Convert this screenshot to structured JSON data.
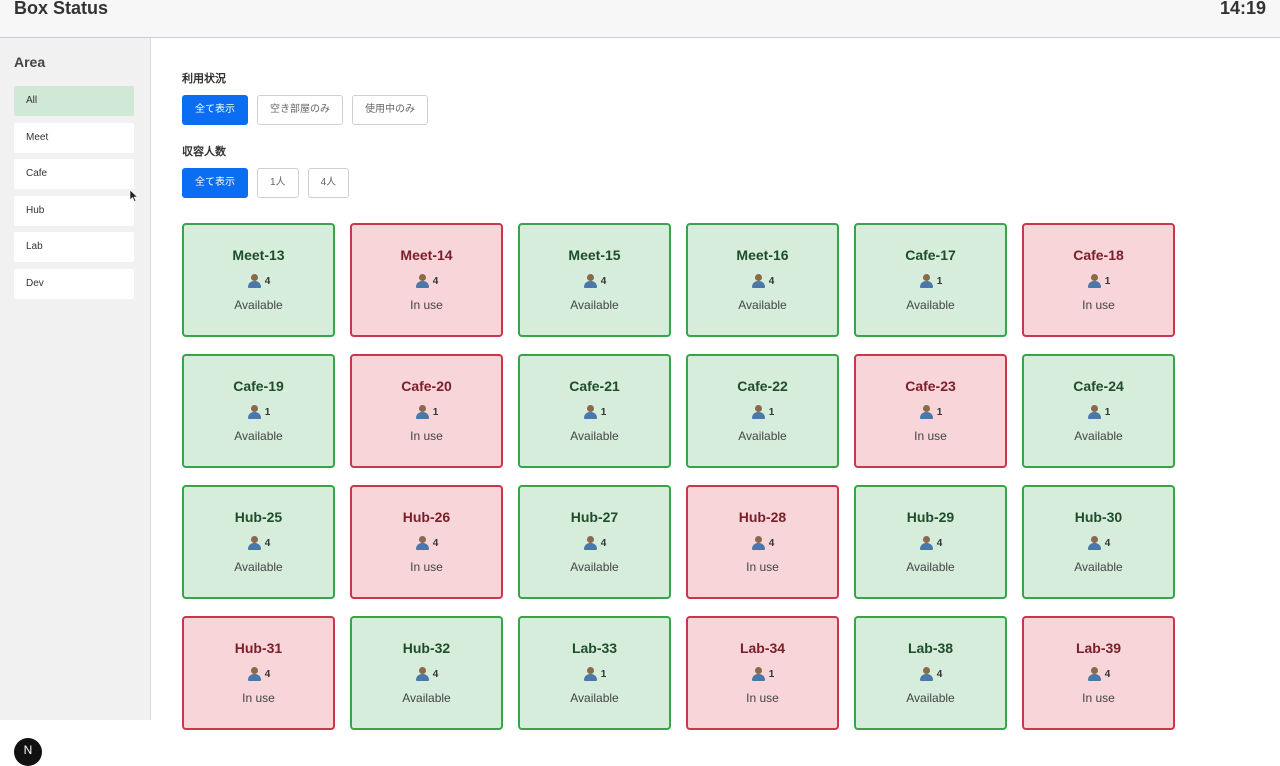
{
  "header": {
    "title": "Box Status",
    "clock": "14:19"
  },
  "sidebar": {
    "title": "Area",
    "items": [
      {
        "label": "All",
        "active": true
      },
      {
        "label": "Meet",
        "active": false
      },
      {
        "label": "Cafe",
        "active": false
      },
      {
        "label": "Hub",
        "active": false
      },
      {
        "label": "Lab",
        "active": false
      },
      {
        "label": "Dev",
        "active": false
      }
    ],
    "badge": "N"
  },
  "filters": {
    "usage": {
      "label": "利用状況",
      "options": [
        {
          "label": "全て表示",
          "active": true
        },
        {
          "label": "空き部屋のみ",
          "active": false
        },
        {
          "label": "使用中のみ",
          "active": false
        }
      ]
    },
    "capacity": {
      "label": "収容人数",
      "options": [
        {
          "label": "全て表示",
          "active": true
        },
        {
          "label": "1人",
          "active": false
        },
        {
          "label": "4人",
          "active": false
        }
      ]
    }
  },
  "rooms": [
    {
      "name": "Meet-13",
      "capacity": "4",
      "status": "Available"
    },
    {
      "name": "Meet-14",
      "capacity": "4",
      "status": "In use"
    },
    {
      "name": "Meet-15",
      "capacity": "4",
      "status": "Available"
    },
    {
      "name": "Meet-16",
      "capacity": "4",
      "status": "Available"
    },
    {
      "name": "Cafe-17",
      "capacity": "1",
      "status": "Available"
    },
    {
      "name": "Cafe-18",
      "capacity": "1",
      "status": "In use"
    },
    {
      "name": "Cafe-19",
      "capacity": "1",
      "status": "Available"
    },
    {
      "name": "Cafe-20",
      "capacity": "1",
      "status": "In use"
    },
    {
      "name": "Cafe-21",
      "capacity": "1",
      "status": "Available"
    },
    {
      "name": "Cafe-22",
      "capacity": "1",
      "status": "Available"
    },
    {
      "name": "Cafe-23",
      "capacity": "1",
      "status": "In use"
    },
    {
      "name": "Cafe-24",
      "capacity": "1",
      "status": "Available"
    },
    {
      "name": "Hub-25",
      "capacity": "4",
      "status": "Available"
    },
    {
      "name": "Hub-26",
      "capacity": "4",
      "status": "In use"
    },
    {
      "name": "Hub-27",
      "capacity": "4",
      "status": "Available"
    },
    {
      "name": "Hub-28",
      "capacity": "4",
      "status": "In use"
    },
    {
      "name": "Hub-29",
      "capacity": "4",
      "status": "Available"
    },
    {
      "name": "Hub-30",
      "capacity": "4",
      "status": "Available"
    },
    {
      "name": "Hub-31",
      "capacity": "4",
      "status": "In use"
    },
    {
      "name": "Hub-32",
      "capacity": "4",
      "status": "Available"
    },
    {
      "name": "Lab-33",
      "capacity": "1",
      "status": "Available"
    },
    {
      "name": "Lab-34",
      "capacity": "1",
      "status": "In use"
    },
    {
      "name": "Lab-38",
      "capacity": "4",
      "status": "Available"
    },
    {
      "name": "Lab-39",
      "capacity": "4",
      "status": "In use"
    }
  ],
  "colors": {
    "available_bg": "#d6eddb",
    "available_border": "#3aa34a",
    "inuse_bg": "#f7d5d8",
    "inuse_border": "#c9374a",
    "accent": "#0a6df2"
  }
}
